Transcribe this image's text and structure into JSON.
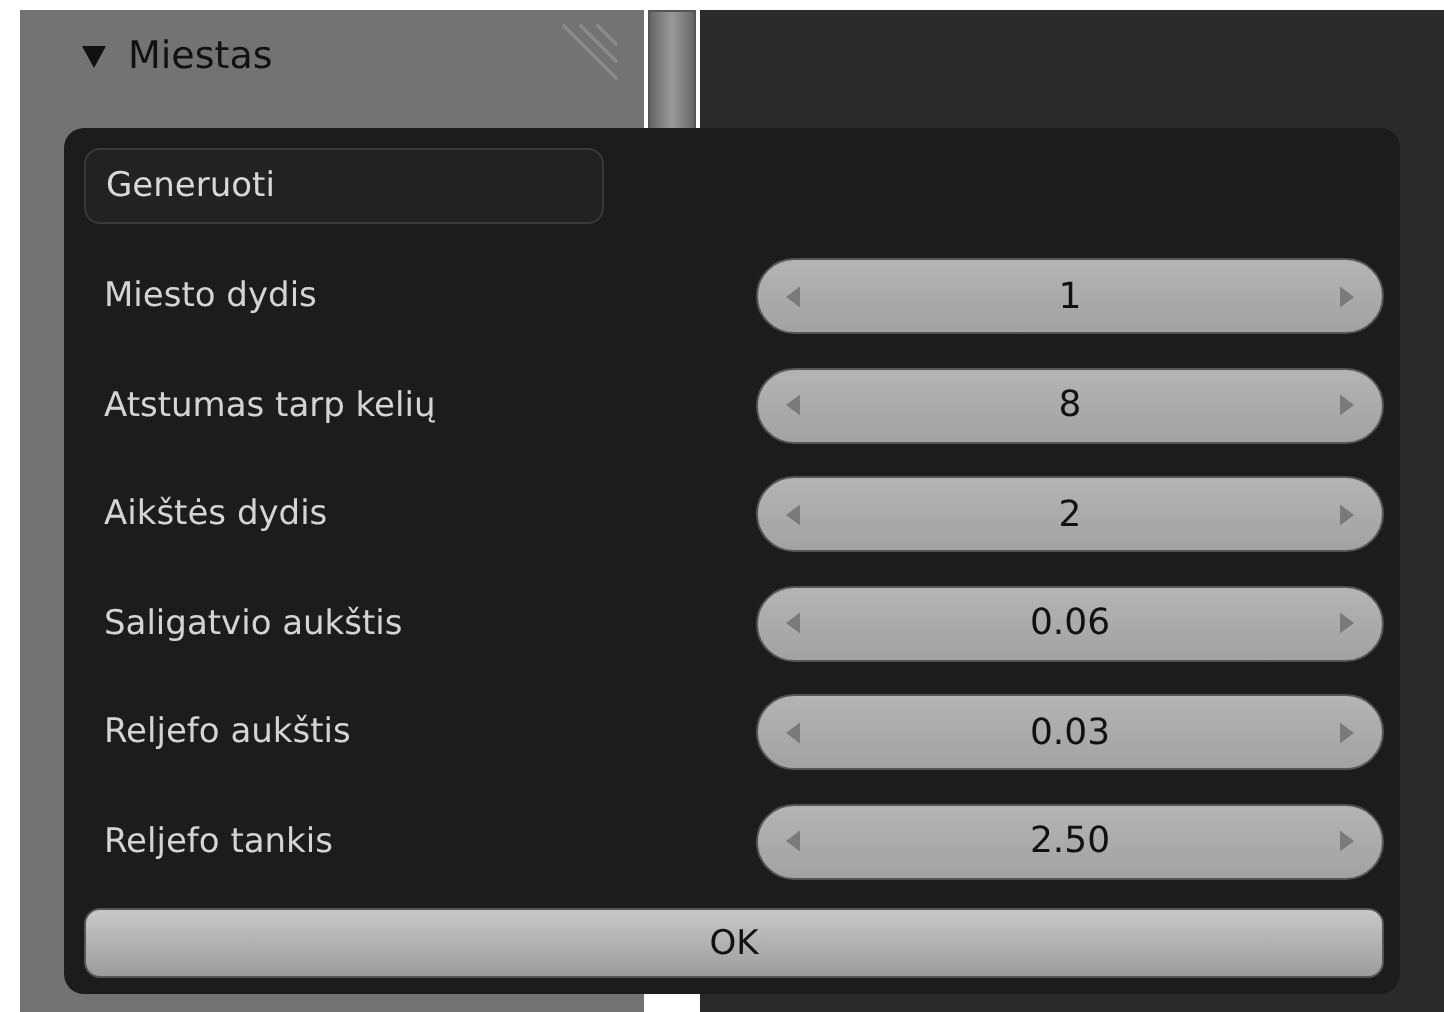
{
  "panel": {
    "section": {
      "label": "Miestas",
      "expanded": true
    }
  },
  "dialog": {
    "generate_button": "Generuoti",
    "fields": [
      {
        "label": "Miesto dydis",
        "value": "1"
      },
      {
        "label": "Atstumas tarp kelių",
        "value": "8"
      },
      {
        "label": "Aikštės dydis",
        "value": "2"
      },
      {
        "label": "Saligatvio aukštis",
        "value": "0.06"
      },
      {
        "label": "Reljefo aukštis",
        "value": "0.03"
      },
      {
        "label": "Reljefo tankis",
        "value": "2.50"
      }
    ],
    "ok_button": "OK"
  }
}
